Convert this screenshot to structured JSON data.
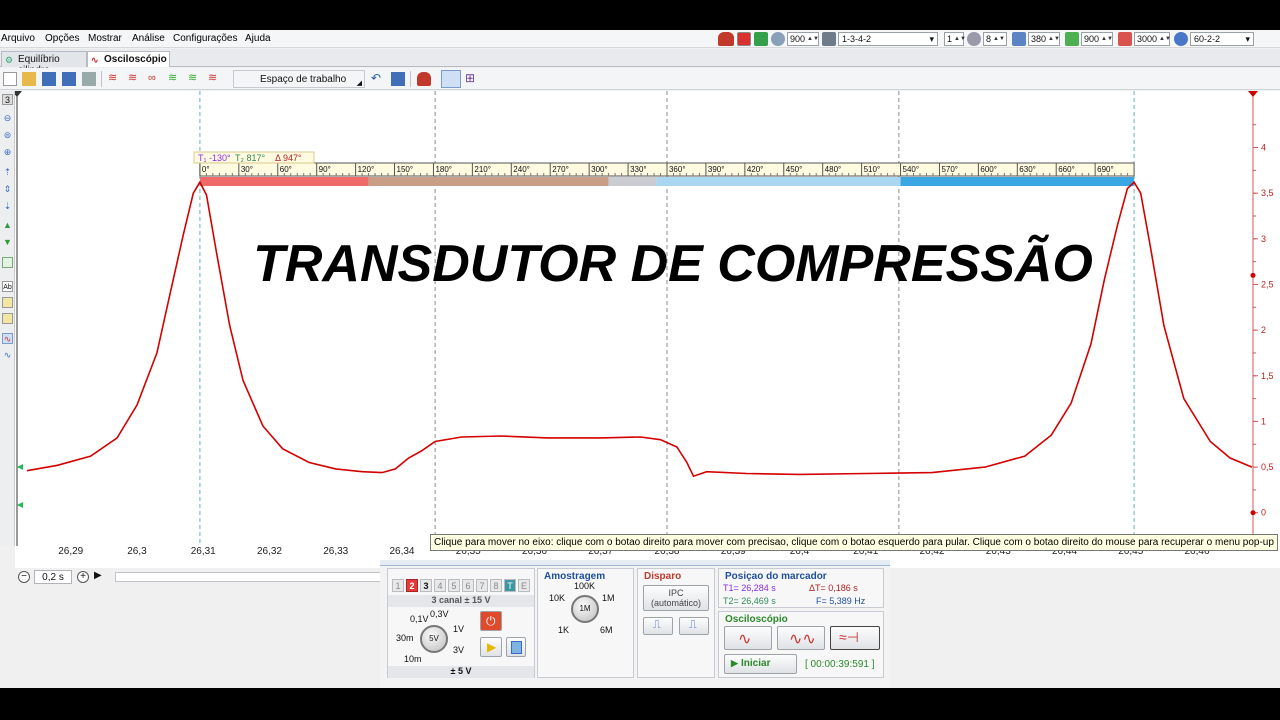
{
  "menubar": {
    "items": [
      "Arquivo",
      "Opções",
      "Mostrar",
      "Análise",
      "Configurações",
      "Ajuda"
    ],
    "controls": {
      "rpm": "900",
      "firing_order": "1-3-4-2",
      "cylinder": "1",
      "cyl_count": "8",
      "val_a": "380",
      "val_b": "900",
      "val_c": "3000",
      "mode": "60-2-2"
    }
  },
  "tabs": [
    {
      "label": "Equilíbrio cilindro",
      "icon": "engine-icon",
      "active": false
    },
    {
      "label": "Osciloscópio",
      "icon": "waveform-icon",
      "active": true
    }
  ],
  "toolbar": {
    "workspace_label": "Espaço de trabalho",
    "channel_indicator": "3"
  },
  "marker_header": {
    "t1": "-130°",
    "t2": "817°",
    "delta": "947°"
  },
  "degree_scale": [
    "0°",
    "30°",
    "60°",
    "90°",
    "120°",
    "150°",
    "180°",
    "210°",
    "240°",
    "270°",
    "300°",
    "330°",
    "360°",
    "390°",
    "420°",
    "450°",
    "480°",
    "510°",
    "540°",
    "570°",
    "600°",
    "630°",
    "660°",
    "690°"
  ],
  "strokes": [
    {
      "color": "#f06a6a",
      "from_deg": 0,
      "to_deg": 130
    },
    {
      "color": "#c89e86",
      "from_deg": 130,
      "to_deg": 315
    },
    {
      "color": "#c9ccd0",
      "from_deg": 315,
      "to_deg": 352
    },
    {
      "color": "#a9d7f2",
      "from_deg": 352,
      "to_deg": 540
    },
    {
      "color": "#3aa7e2",
      "from_deg": 540,
      "to_deg": 720
    }
  ],
  "overlay_title": "TRANSDUTOR DE COMPRESSÃO",
  "chart_data": {
    "type": "line",
    "title": "",
    "xlabel": "",
    "ylabel": "",
    "xlim": [
      26.2834,
      26.4683
    ],
    "ylim": [
      -0.2,
      4.4
    ],
    "x_ticks": [
      "26,29",
      "26,3",
      "26,31",
      "26,32",
      "26,33",
      "26,34",
      "26,35",
      "26,36",
      "26,37",
      "26,38",
      "26,39",
      "26,4",
      "26,41",
      "26,42",
      "26,43",
      "26,44",
      "26,45",
      "26,46"
    ],
    "y_ticks": [
      "0",
      "0,5",
      "1",
      "1,5",
      "2",
      "2,5",
      "3",
      "3,5",
      "4"
    ],
    "line_color": "#d40000",
    "grid": "vertical dashed markers",
    "markers_x": [
      26.3095,
      26.345,
      26.38,
      26.415,
      26.4505
    ],
    "series": [
      {
        "x": [
          26.2834,
          26.288,
          26.293,
          26.297,
          26.3,
          26.303,
          26.305,
          26.307,
          26.3085,
          26.3095,
          26.3105,
          26.312,
          26.314,
          26.316,
          26.319,
          26.322,
          26.326,
          26.33,
          26.334,
          26.337,
          26.339,
          26.341,
          26.343,
          26.345,
          26.349,
          26.355,
          26.362,
          26.37,
          26.376,
          26.379,
          26.3815,
          26.383,
          26.384,
          26.386,
          26.392,
          26.4,
          26.41,
          26.42,
          26.428,
          26.434,
          26.438,
          26.441,
          26.444,
          26.446,
          26.448,
          26.4495,
          26.4505,
          26.4515,
          26.453,
          26.455,
          26.458,
          26.462,
          26.465,
          26.4683
        ],
        "y": [
          0.46,
          0.52,
          0.62,
          0.82,
          1.18,
          1.75,
          2.4,
          3.05,
          3.5,
          3.62,
          3.48,
          2.85,
          2.05,
          1.45,
          0.95,
          0.7,
          0.55,
          0.48,
          0.45,
          0.44,
          0.48,
          0.6,
          0.68,
          0.78,
          0.83,
          0.84,
          0.82,
          0.82,
          0.83,
          0.8,
          0.72,
          0.55,
          0.4,
          0.45,
          0.43,
          0.42,
          0.43,
          0.44,
          0.5,
          0.62,
          0.85,
          1.2,
          1.85,
          2.55,
          3.15,
          3.55,
          3.62,
          3.5,
          2.9,
          2.05,
          1.25,
          0.78,
          0.6,
          0.5
        ]
      }
    ]
  },
  "zoom": {
    "value": "0,2 s"
  },
  "tooltip": "Clique para mover no eixo: clique com o botao direito para mover com precisao, clique com o botao esquerdo para pular. Clique com o botao direito do mouse para recuperar o menu pop-up",
  "panel": {
    "channels": [
      "1",
      "2",
      "3",
      "4",
      "5",
      "6",
      "7",
      "8",
      "T",
      "E"
    ],
    "channel_title": "3 canal ± 15 V",
    "range_labels": [
      "0,1V",
      "0,3V",
      "1V",
      "3V",
      "30m",
      "10m"
    ],
    "knob_value": "5V",
    "range_value": "± 5 V",
    "amostragem": {
      "title": "Amostragem",
      "labels": [
        "100K",
        "10K",
        "1M",
        "1K",
        "6M"
      ],
      "knob": "1M"
    },
    "disparo": {
      "title": "Disparo",
      "mode_line1": "IPC",
      "mode_line2": "(automático)"
    },
    "posicao": {
      "title": "Posiçao do marcador",
      "t1": "T1= 26,284 s",
      "t2": "T2= 26,469 s",
      "dt": "ΔT= 0,186 s",
      "f": "F= 5,389 Hz"
    },
    "osciloscopio": {
      "title": "Osciloscópio",
      "start": "Iniciar",
      "timer": "[ 00:00:39:591 ]"
    }
  }
}
